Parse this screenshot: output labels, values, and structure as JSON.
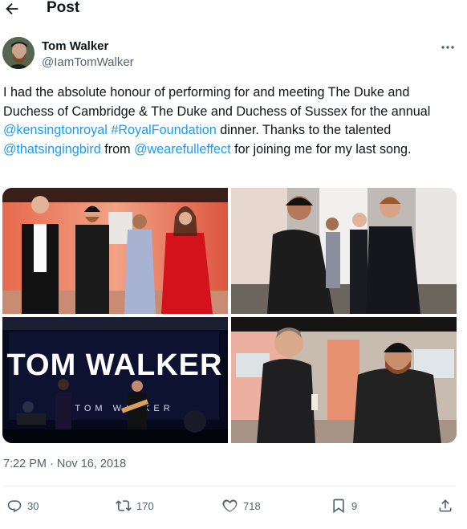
{
  "header": {
    "title": "Post",
    "back_icon": "arrow-left-icon"
  },
  "author": {
    "name": "Tom Walker",
    "handle": "@IamTomWalker",
    "avatar_icon": "avatar-photo",
    "more_icon": "more-horizontal-icon"
  },
  "tweet": {
    "segments": [
      {
        "text": "I had the absolute honour of performing for and meeting The Duke and Duchess of Cambridge & The Duke and Duchess of Sussex for the annual ",
        "link": false
      },
      {
        "text": "@kensingtonroyal",
        "link": true
      },
      {
        "text": " ",
        "link": false
      },
      {
        "text": "#RoyalFoundation",
        "link": true
      },
      {
        "text": " dinner. Thanks to the talented ",
        "link": false
      },
      {
        "text": "@thatsingingbird",
        "link": true
      },
      {
        "text": " from ",
        "link": false
      },
      {
        "text": "@wearefulleffect",
        "link": true
      },
      {
        "text": " for joining me for my last song.",
        "link": false
      }
    ]
  },
  "media": {
    "photos": [
      {
        "name": "photo-group-portrait"
      },
      {
        "name": "photo-meeting-duke-of-sussex"
      },
      {
        "name": "photo-concert-stage",
        "sign_line1": "TOM WALKER",
        "sign_line2": "@ TOM WALKER"
      },
      {
        "name": "photo-meeting-duke-of-cambridge"
      }
    ]
  },
  "timestamp": "7:22 PM · Nov 16, 2018",
  "actions": {
    "replies": {
      "icon": "reply-icon",
      "count": "30"
    },
    "retweets": {
      "icon": "retweet-icon",
      "count": "170"
    },
    "likes": {
      "icon": "heart-icon",
      "count": "718"
    },
    "bookmarks": {
      "icon": "bookmark-icon",
      "count": "9"
    },
    "share": {
      "icon": "share-icon"
    }
  },
  "colors": {
    "link": "#1d9bf0",
    "secondary_text": "#536471",
    "primary_text": "#0f1419"
  }
}
